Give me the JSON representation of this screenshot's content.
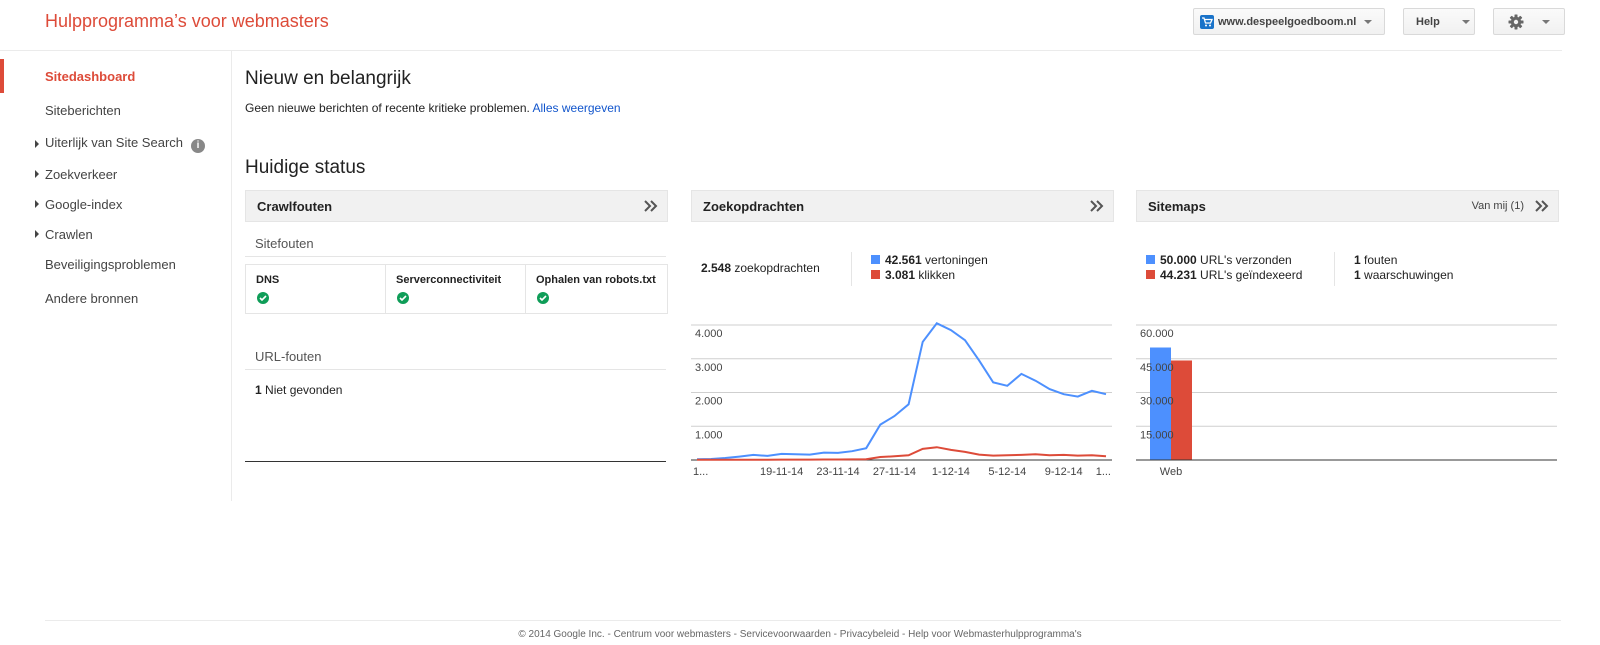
{
  "app": {
    "title": "Hulpprogramma’s voor webmasters"
  },
  "topbar": {
    "site_selector": "www.despeelgoedboom.nl",
    "help_label": "Help"
  },
  "sidebar": {
    "items": [
      {
        "label": "Sitedashboard",
        "active": true,
        "expandable": false
      },
      {
        "label": "Siteberichten",
        "expandable": false
      },
      {
        "label": "Uiterlijk van Site Search",
        "expandable": true,
        "info": true
      },
      {
        "label": "Zoekverkeer",
        "expandable": true
      },
      {
        "label": "Google-index",
        "expandable": true
      },
      {
        "label": "Crawlen",
        "expandable": true
      },
      {
        "label": "Beveiligingsproblemen",
        "expandable": false
      },
      {
        "label": "Andere bronnen",
        "expandable": false
      }
    ]
  },
  "main": {
    "new_heading": "Nieuw en belangrijk",
    "new_message": "Geen nieuwe berichten of recente kritieke problemen.",
    "new_link": "Alles weergeven",
    "status_heading": "Huidige status",
    "crawl": {
      "title": "Crawlfouten",
      "site_errors_label": "Sitefouten",
      "columns": [
        "DNS",
        "Serverconnectiviteit",
        "Ophalen van robots.txt"
      ],
      "url_errors_label": "URL-fouten",
      "url_error_count": "1",
      "url_error_text": "Niet gevonden"
    },
    "queries": {
      "title": "Zoekopdrachten",
      "total_count": "2.548",
      "total_label": "zoekopdrachten",
      "impressions_count": "42.561",
      "impressions_label": "vertoningen",
      "clicks_count": "3.081",
      "clicks_label": "klikken"
    },
    "sitemaps": {
      "title": "Sitemaps",
      "filter_label": "Van mij (1)",
      "submitted_count": "50.000",
      "submitted_label": "URL's verzonden",
      "indexed_count": "44.231",
      "indexed_label": "URL's geïndexeerd",
      "errors_count": "1",
      "errors_label": "fouten",
      "warnings_count": "1",
      "warnings_label": "waarschuwingen"
    }
  },
  "colors": {
    "blue": "#4d90fe",
    "red": "#dd4b39",
    "green": "#0f9d58"
  },
  "chart_data": [
    {
      "type": "line",
      "x": [
        "1...",
        "",
        "",
        "",
        "",
        "",
        "19-11-14",
        "",
        "",
        "",
        "23-11-14",
        "",
        "",
        "",
        "27-11-14",
        "",
        "",
        "",
        "1-12-14",
        "",
        "",
        "",
        "5-12-14",
        "",
        "",
        "",
        "9-12-14",
        "",
        "",
        "1..."
      ],
      "xticks": [
        "1...",
        "19-11-14",
        "23-11-14",
        "27-11-14",
        "1-12-14",
        "5-12-14",
        "9-12-14",
        "1..."
      ],
      "yticks": [
        "1.000",
        "2.000",
        "3.000",
        "4.000"
      ],
      "ylim": [
        0,
        4000
      ],
      "grid": true,
      "series": [
        {
          "name": "vertoningen",
          "color": "#4d90fe",
          "values": [
            20,
            30,
            60,
            100,
            150,
            120,
            180,
            170,
            160,
            220,
            210,
            260,
            350,
            1050,
            1300,
            1650,
            3500,
            4050,
            3850,
            3550,
            2950,
            2300,
            2200,
            2550,
            2350,
            2100,
            1950,
            1880,
            2050,
            1950
          ]
        },
        {
          "name": "klikken",
          "color": "#dd4b39",
          "values": [
            5,
            5,
            5,
            8,
            10,
            10,
            12,
            12,
            12,
            15,
            15,
            18,
            25,
            90,
            110,
            140,
            330,
            380,
            300,
            240,
            160,
            130,
            140,
            150,
            170,
            140,
            150,
            130,
            140,
            110
          ]
        }
      ]
    },
    {
      "type": "bar",
      "categories": [
        "Web"
      ],
      "yticks": [
        "15.000",
        "30.000",
        "45.000",
        "60.000"
      ],
      "ylim": [
        0,
        60000
      ],
      "grid": true,
      "series": [
        {
          "name": "URL's verzonden",
          "color": "#4d90fe",
          "values": [
            50000
          ]
        },
        {
          "name": "URL's geïndexeerd",
          "color": "#dd4b39",
          "values": [
            44231
          ]
        }
      ]
    }
  ],
  "footer": {
    "copyright": "© 2014 Google Inc.",
    "links": [
      "Centrum voor webmasters",
      "Servicevoorwaarden",
      "Privacybeleid",
      "Help voor Webmasterhulpprogramma's"
    ]
  }
}
